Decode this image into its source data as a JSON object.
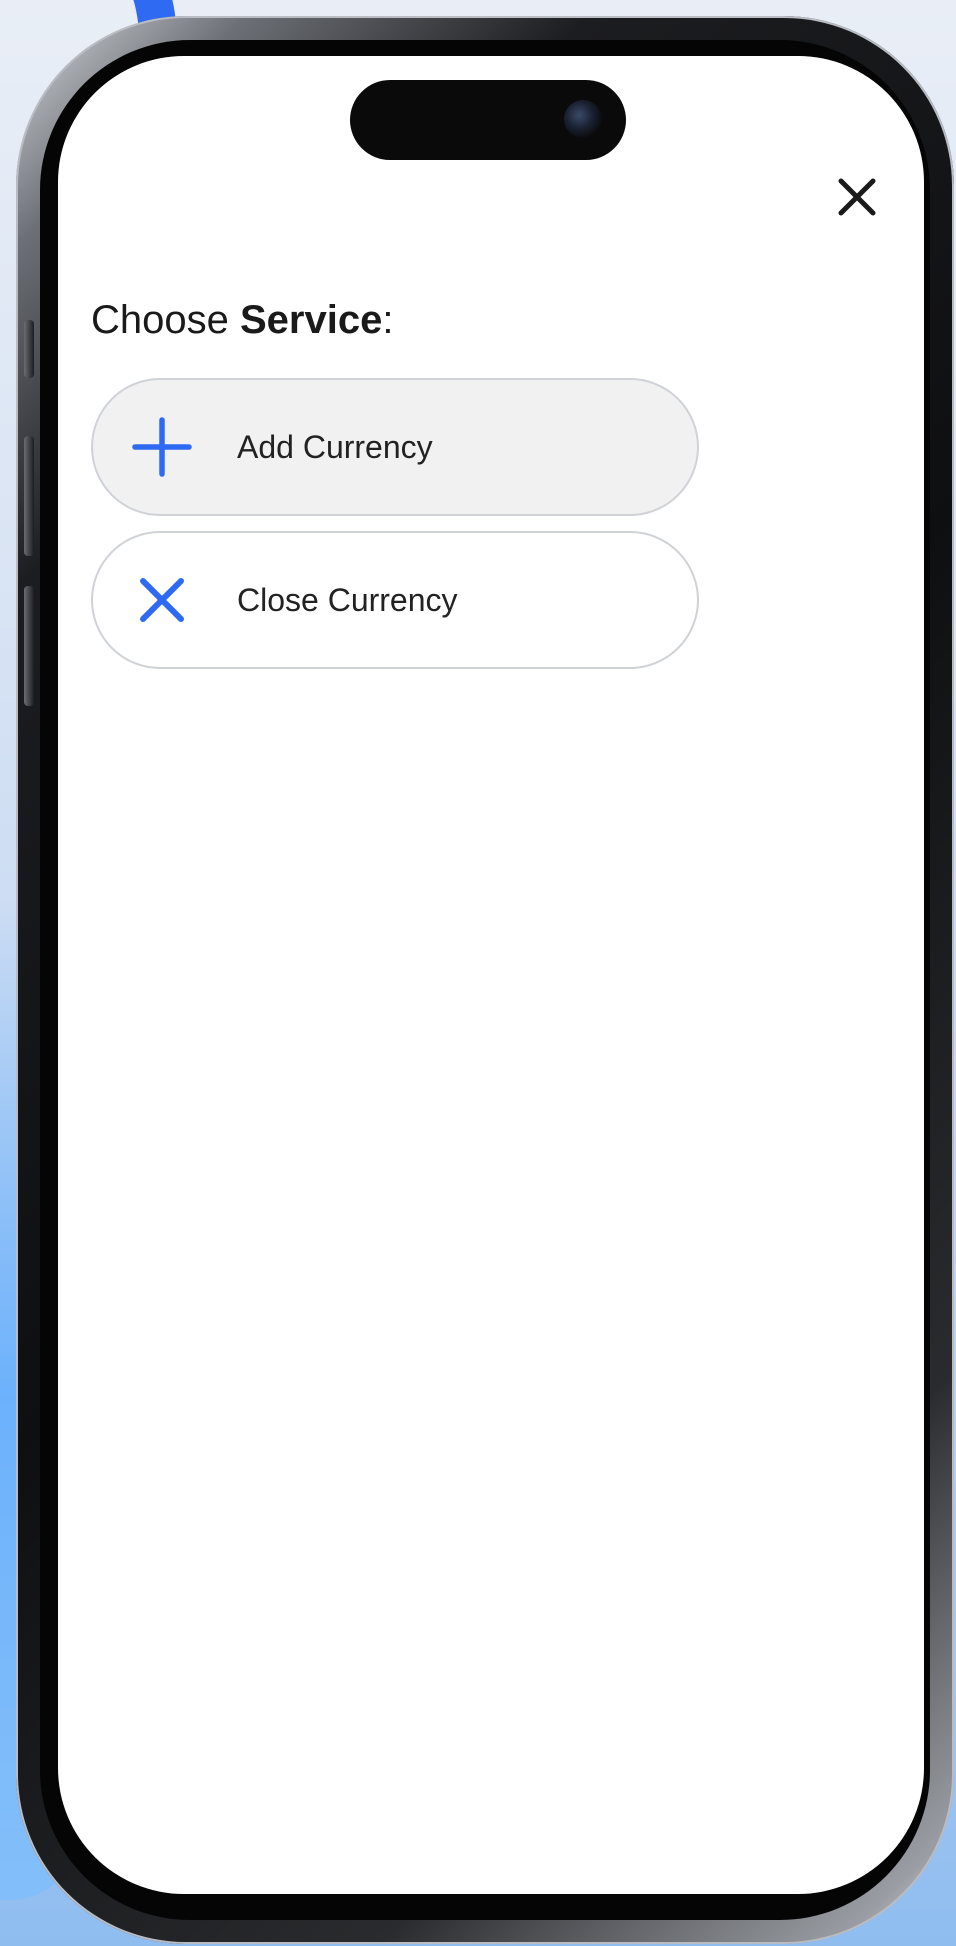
{
  "colors": {
    "accent": "#2f6bf2",
    "text": "#1a1a1a",
    "button_border": "#cfd2d6",
    "add_button_bg": "#f1f1f2"
  },
  "header": {
    "close_icon": "close-icon"
  },
  "title": {
    "prefix": "Choose ",
    "bold": "Service",
    "suffix": ":"
  },
  "services": {
    "add": {
      "label": "Add Currency",
      "icon": "plus-icon"
    },
    "close": {
      "label": "Close Currency",
      "icon": "x-icon"
    }
  }
}
